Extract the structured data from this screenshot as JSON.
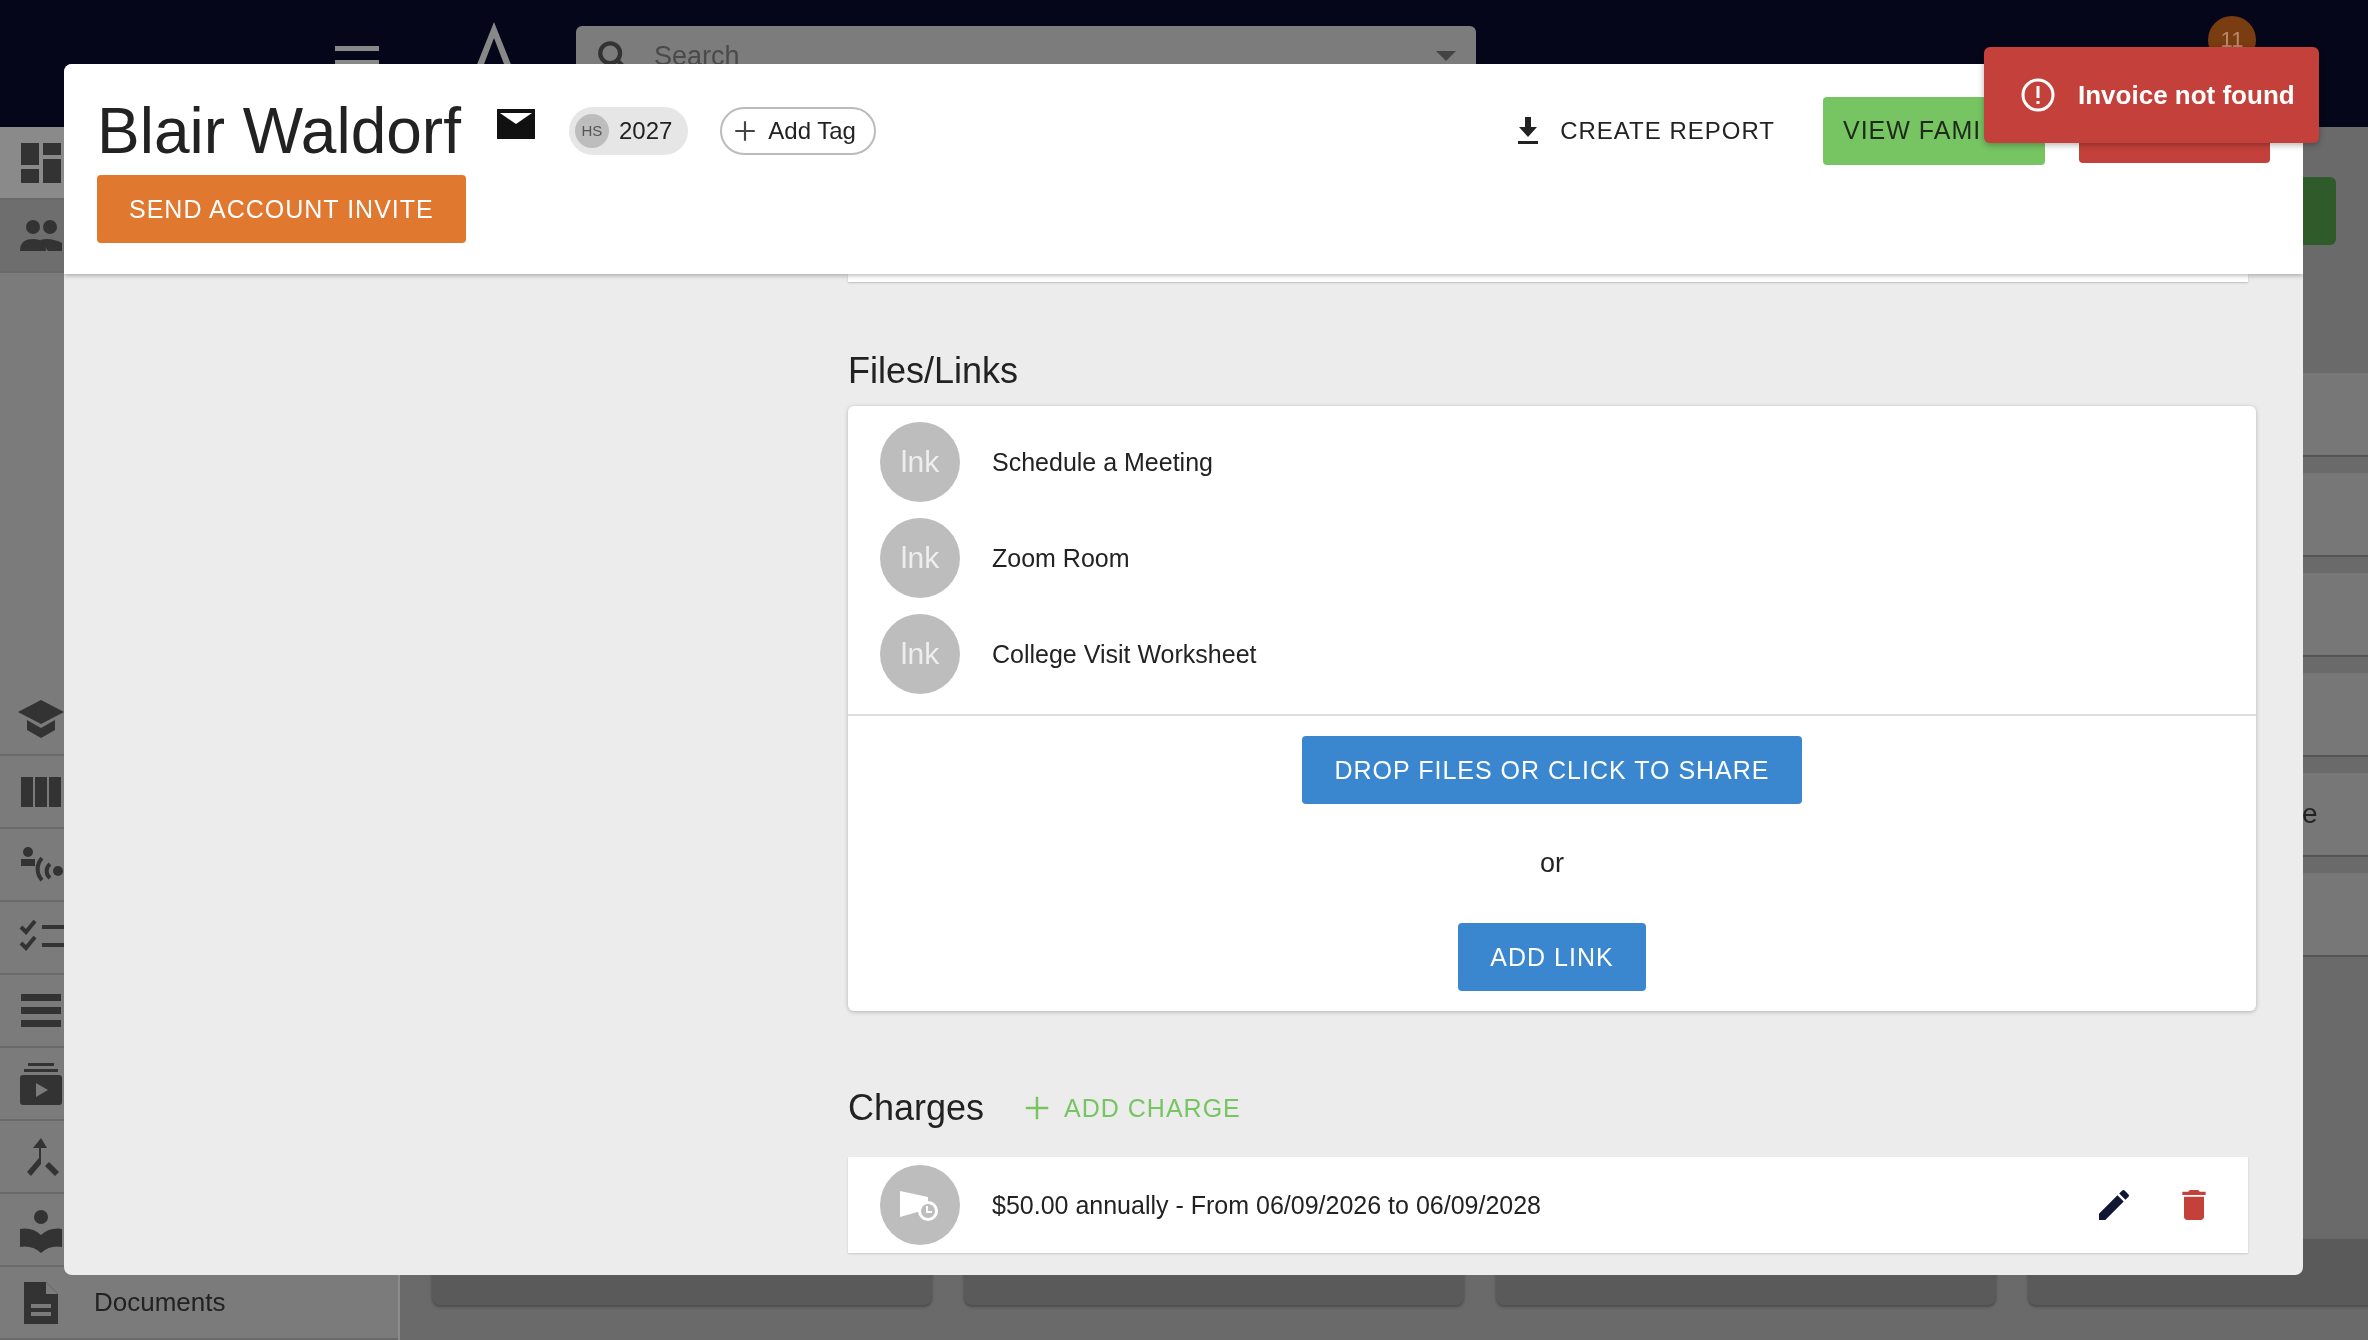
{
  "app_bar": {
    "search": {
      "placeholder": "Search"
    },
    "notification_badge": "11"
  },
  "sidebar": {
    "upper_items": [
      {
        "selected": false
      },
      {
        "selected": true
      }
    ],
    "lower_items": [
      {
        "selected": false
      },
      {
        "selected": false
      },
      {
        "selected": false
      },
      {
        "selected": false
      },
      {
        "selected": false
      },
      {
        "selected": false
      },
      {
        "selected": false
      },
      {
        "selected": false
      },
      {
        "selected": false,
        "label": "Documents"
      }
    ]
  },
  "right_panel": {
    "partial_text": "e"
  },
  "modal": {
    "title": "Blair Waldorf",
    "tag": {
      "badge": "HS",
      "label": "2027"
    },
    "add_tag": "Add Tag",
    "send_invite_button": "SEND ACCOUNT INVITE",
    "create_report": "CREATE REPORT",
    "view_family_button": "VIEW FAMI",
    "files": {
      "heading": "Files/Links",
      "links": [
        {
          "avatar": "lnk",
          "label": "Schedule a Meeting"
        },
        {
          "avatar": "lnk",
          "label": "Zoom Room"
        },
        {
          "avatar": "lnk",
          "label": "College Visit Worksheet"
        }
      ],
      "upload_button": "DROP FILES OR CLICK TO SHARE",
      "or_text": "or",
      "add_link_button": "ADD LINK"
    },
    "charges": {
      "heading": "Charges",
      "add_button": "ADD CHARGE",
      "items": [
        {
          "text": "$50.00 annually - From 06/09/2026 to 06/09/2028"
        }
      ]
    }
  },
  "toast": {
    "kind": "error",
    "message": "Invoice not found"
  }
}
